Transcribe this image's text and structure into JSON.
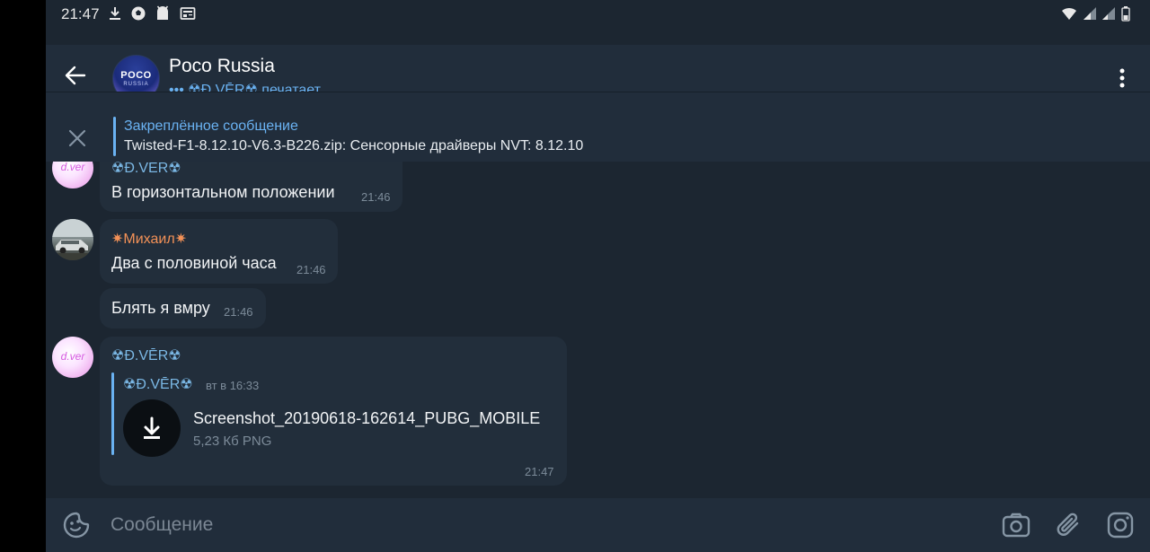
{
  "status_bar": {
    "time": "21:47",
    "icons": [
      "download-icon",
      "soccer-ball-icon",
      "android-icon",
      "news-icon",
      "wifi-icon",
      "signal-icon",
      "signal-icon",
      "battery-icon"
    ]
  },
  "header": {
    "title": "Poco Russia",
    "avatar_text": "POCO",
    "avatar_subtext": "RUSSIA",
    "typing_status": "••• ☢Đ.VĒR☢ печатает"
  },
  "pinned": {
    "title": "Закреплённое сообщение",
    "text": "Twisted-F1-8.12.10-V6.3-B226.zip: Сенсорные драйверы NVT: 8.12.10"
  },
  "messages": [
    {
      "sender": "☢Đ.VĒR☢",
      "avatar_text": "d.ver",
      "text": "В горизонтальном положении",
      "time": "21:46"
    },
    {
      "sender": "✷Михаил✷",
      "text": "Два с половиной часа",
      "time": "21:46"
    },
    {
      "text": "Блять я вмру",
      "time": "21:46"
    },
    {
      "sender": "☢Đ.VĒR☢",
      "avatar_text": "d.ver",
      "forward_from": "☢Đ.VĒR☢",
      "forward_date": "вт в 16:33",
      "file_name": "Screenshot_20190618-162614_PUBG_MOBILE",
      "file_meta": "5,23 Кб PNG",
      "time": "21:47"
    }
  ],
  "input": {
    "placeholder": "Сообщение"
  },
  "colors": {
    "background": "#1c2631",
    "header": "#212d3b",
    "bubble": "#222e3b",
    "accent": "#6ab2f2",
    "orange_name": "#f39157"
  }
}
